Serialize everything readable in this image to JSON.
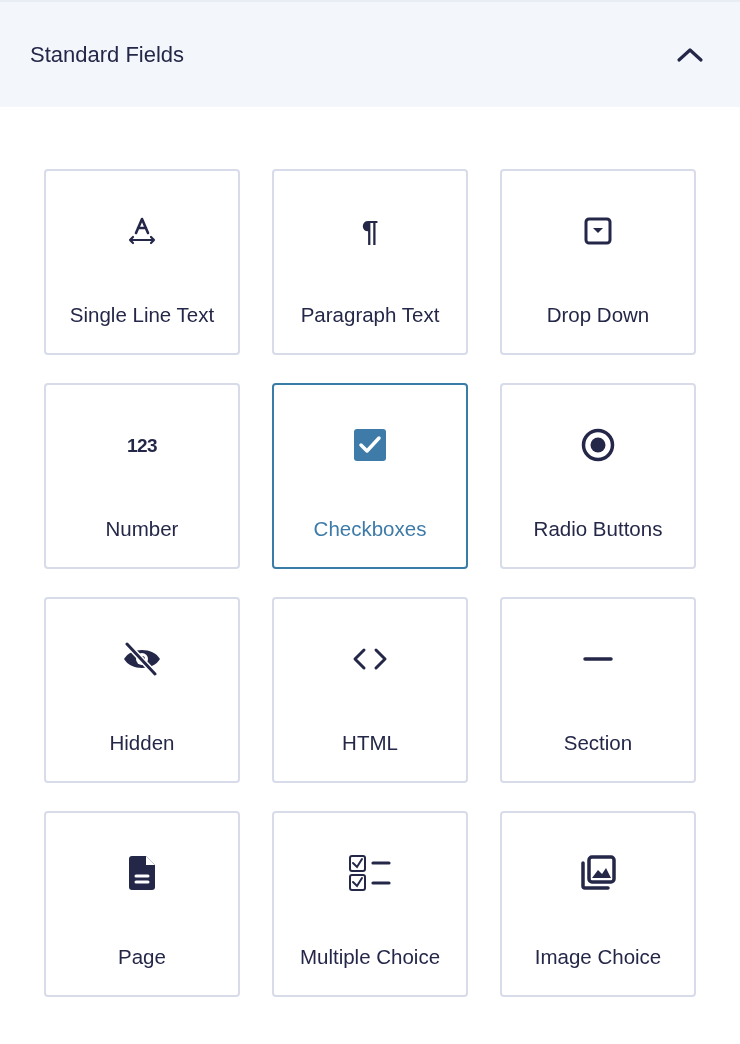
{
  "panel": {
    "title": "Standard Fields",
    "expanded": true
  },
  "fields": [
    {
      "label": "Single Line Text",
      "kind": "text",
      "selected": false
    },
    {
      "label": "Paragraph Text",
      "kind": "glyph",
      "icon_text": "¶",
      "selected": false
    },
    {
      "label": "Drop Down",
      "kind": "dropdown",
      "selected": false
    },
    {
      "label": "Number",
      "kind": "glyph",
      "icon_text": "123",
      "selected": false
    },
    {
      "label": "Checkboxes",
      "kind": "checkbox",
      "selected": true
    },
    {
      "label": "Radio Buttons",
      "kind": "radio",
      "selected": false
    },
    {
      "label": "Hidden",
      "kind": "hidden",
      "selected": false
    },
    {
      "label": "HTML",
      "kind": "html",
      "selected": false
    },
    {
      "label": "Section",
      "kind": "section",
      "selected": false
    },
    {
      "label": "Page",
      "kind": "page",
      "selected": false
    },
    {
      "label": "Multiple Choice",
      "kind": "multiple",
      "selected": false
    },
    {
      "label": "Image Choice",
      "kind": "image",
      "selected": false
    }
  ]
}
